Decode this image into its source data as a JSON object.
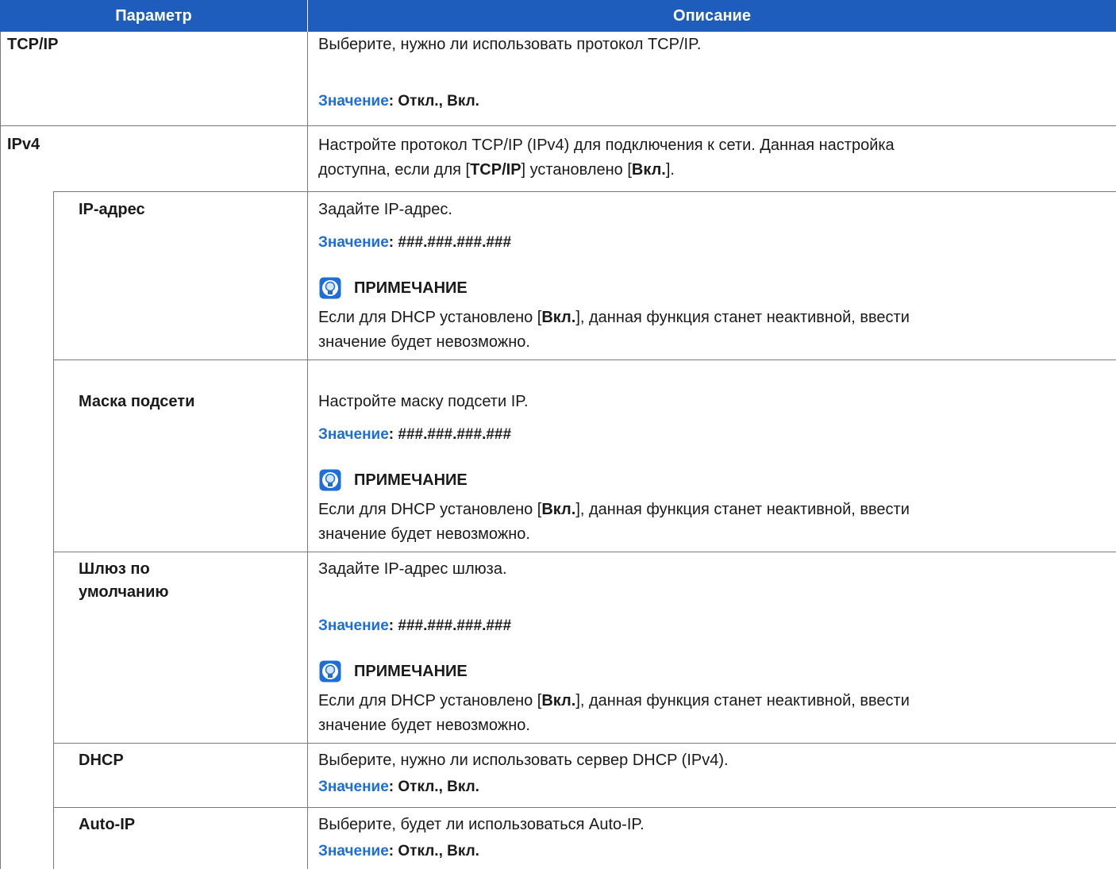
{
  "header": {
    "param": "Параметр",
    "desc": "Описание"
  },
  "value_key": "Значение",
  "value_sep": ": ",
  "note_title": "ПРИМЕЧАНИЕ",
  "rows": {
    "tcpip": {
      "name": "TCP/IP",
      "desc": "Выберите, нужно ли использовать протокол TCP/IP.",
      "value": "Откл., Вкл."
    },
    "ipv4": {
      "name": "IPv4",
      "desc1_a": "Настройте протокол TCP/IP (IPv4) для подключения к сети. Данная настройка",
      "desc2_a": "доступна, если для [",
      "desc2_b": "TCP/IP",
      "desc2_c": "] установлено [",
      "desc2_d": "Вкл.",
      "desc2_e": "]."
    },
    "ip": {
      "name": "IP-адрес",
      "desc": "Задайте IP-адрес.",
      "value": "###.###.###.###"
    },
    "mask": {
      "name": "Маска подсети",
      "desc": "Настройте маску подсети IP.",
      "value": "###.###.###.###"
    },
    "gateway": {
      "name1": "Шлюз по",
      "name2": "умолчанию",
      "desc": "Задайте IP-адрес шлюза.",
      "value": "###.###.###.###"
    },
    "dhcp": {
      "name": "DHCP",
      "desc": "Выберите, нужно ли использовать сервер DHCP (IPv4).",
      "value": "Откл., Вкл."
    },
    "autoip": {
      "name": "Auto-IP",
      "desc": "Выберите, будет ли использоваться Auto-IP.",
      "value": "Откл., Вкл."
    }
  },
  "note_text": {
    "line1_a": "Если для DHCP установлено [",
    "line1_b": "Вкл.",
    "line1_c": "], данная функция станет неактивной, ввести",
    "line2": "значение будет невозможно."
  }
}
